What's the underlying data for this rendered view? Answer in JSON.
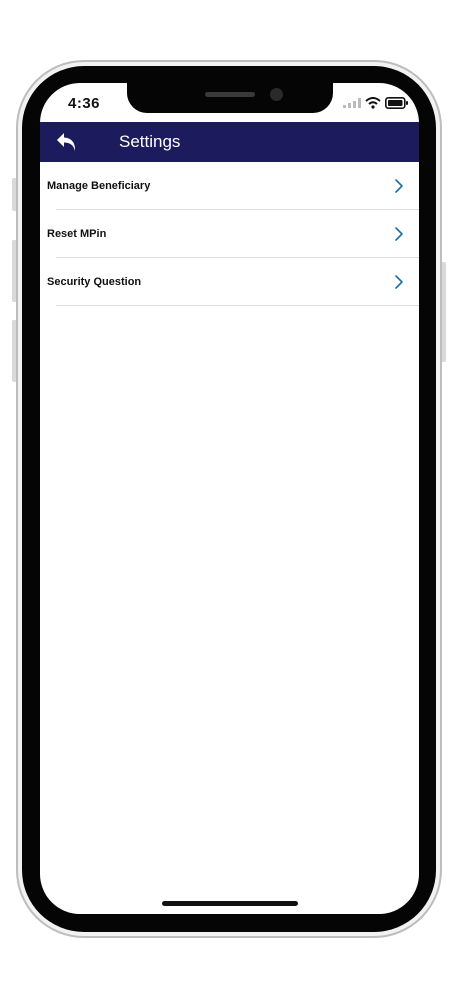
{
  "status_bar": {
    "time": "4:36"
  },
  "header": {
    "title": "Settings",
    "back_icon": "back-arrow-icon",
    "background_color": "#1b1b5e"
  },
  "settings": {
    "items": [
      {
        "label": "Manage Beneficiary",
        "icon": "chevron-right-icon"
      },
      {
        "label": "Reset MPin",
        "icon": "chevron-right-icon"
      },
      {
        "label": "Security Question",
        "icon": "chevron-right-icon"
      }
    ]
  },
  "colors": {
    "accent": "#1a6fb3",
    "navbar": "#1b1b5e"
  }
}
